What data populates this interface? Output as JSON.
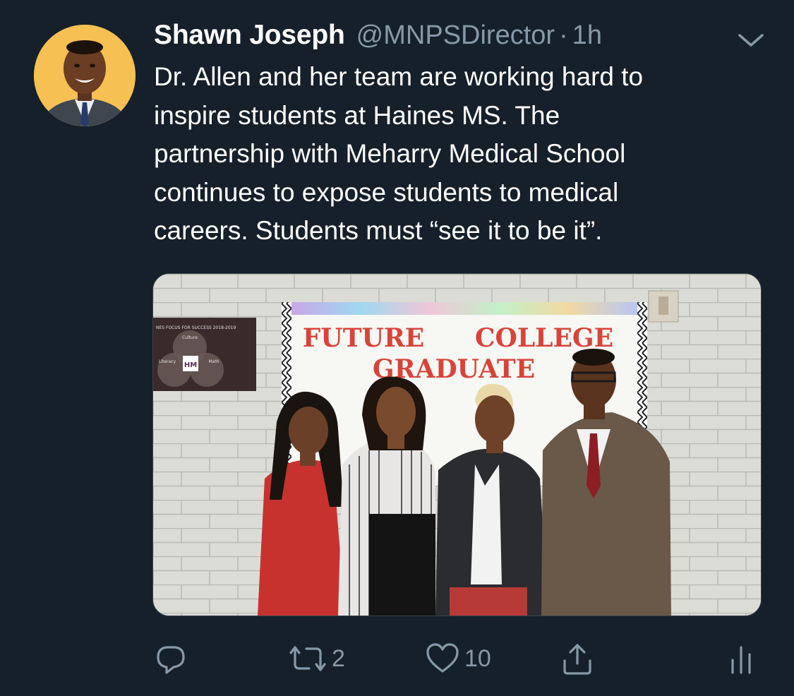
{
  "tweet": {
    "author_name": "Shawn Joseph",
    "handle": "@MNPSDirector",
    "separator": "·",
    "time": "1h",
    "text_lines": [
      "Dr. Allen and her team are working hard to",
      "inspire students at Haines MS.  The",
      "partnership with Meharry Medical School",
      "continues to expose students to medical",
      "careers.  Students must “see it to be it”."
    ],
    "photo": {
      "banner_line1_left": "FUTURE",
      "banner_line1_right": "COLLEGE",
      "banner_line2": "GRADUATE",
      "poster_title": "NES FOCUS FOR SUCCESS 2018-2019",
      "poster_logo": "HM",
      "poster_circle_top": "Culture",
      "poster_circle_left": "Literacy",
      "poster_circle_right": "Math"
    },
    "actions": {
      "reply_icon": "reply-icon",
      "retweet_icon": "retweet-icon",
      "retweet_count": "2",
      "like_icon": "heart-icon",
      "like_count": "10",
      "share_icon": "share-icon",
      "analytics_icon": "analytics-icon"
    },
    "colors": {
      "background": "#15202b",
      "secondary_text": "#8899a6",
      "banner_red": "#d8443a"
    }
  }
}
